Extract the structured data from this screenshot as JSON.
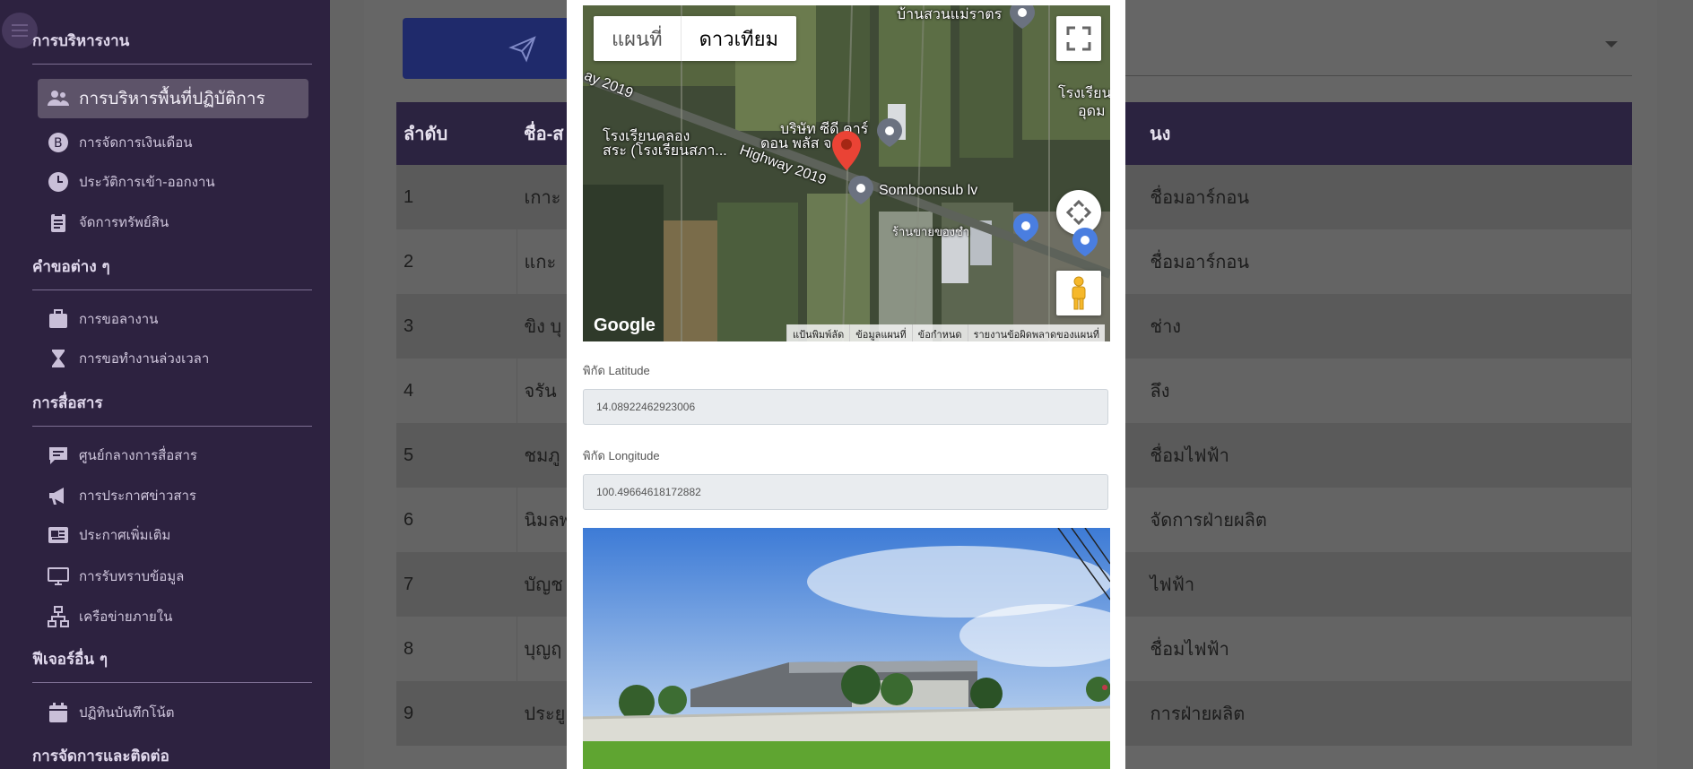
{
  "sidebar": {
    "sections": [
      {
        "title": "การบริหารงาน"
      },
      {
        "title": "คำขอต่าง ๆ"
      },
      {
        "title": "การสื่อสาร"
      },
      {
        "title": "ฟีเจอร์อื่น ๆ"
      },
      {
        "title": "การจัดการและติดต่อ"
      }
    ],
    "items": [
      {
        "label": "การบริหารพื้นที่ปฏิบัติการ",
        "icon": "users-icon",
        "active": true
      },
      {
        "label": "การจัดการเงินเดือน",
        "icon": "bitcoin-icon"
      },
      {
        "label": "ประวัติการเข้า-ออกงาน",
        "icon": "clock-icon"
      },
      {
        "label": "จัดการทรัพย์สิน",
        "icon": "clipboard-icon"
      },
      {
        "label": "การขอลางาน",
        "icon": "briefcase-icon"
      },
      {
        "label": "การขอทำงานล่วงเวลา",
        "icon": "hourglass-icon"
      },
      {
        "label": "ศูนย์กลางการสื่อสาร",
        "icon": "chat-icon"
      },
      {
        "label": "การประกาศข่าวสาร",
        "icon": "megaphone-icon"
      },
      {
        "label": "ประกาศเพิ่มเติม",
        "icon": "newspaper-icon"
      },
      {
        "label": "การรับทราบข้อมูล",
        "icon": "monitor-icon"
      },
      {
        "label": "เครือข่ายภายใน",
        "icon": "network-icon"
      },
      {
        "label": "ปฏิทินบันทึกโน้ต",
        "icon": "calendar-icon"
      }
    ]
  },
  "table": {
    "headers": [
      "ลำดับ",
      "ชื่อ-ส",
      "นง"
    ],
    "rows": [
      {
        "no": "1",
        "name": "เกาะ",
        "pos": "ชื่อมอาร์กอน"
      },
      {
        "no": "2",
        "name": "แกะ",
        "pos": "ชื่อมอาร์กอน"
      },
      {
        "no": "3",
        "name": "ขิง บุ",
        "pos": "ช่าง"
      },
      {
        "no": "4",
        "name": "จรัน",
        "pos": "ลึง"
      },
      {
        "no": "5",
        "name": "ชมภู",
        "pos": "ชื่อมไฟฟ้า"
      },
      {
        "no": "6",
        "name": "นิมลพ",
        "pos": "จัดการฝ่ายผลิต"
      },
      {
        "no": "7",
        "name": "บัญช",
        "pos": "ไฟฟ้า"
      },
      {
        "no": "8",
        "name": "บุญฤ",
        "pos": "ชื่อมไฟฟ้า"
      },
      {
        "no": "9",
        "name": "ประยู",
        "pos": "การฝ่ายผลิต"
      }
    ]
  },
  "map": {
    "type_map": "แผนที่",
    "type_satellite": "ดาวเทียม",
    "labels": {
      "place_top": "บ้านสวนแม่ราตร",
      "school_right": "โรงเรียน",
      "school_right2": "อุดม",
      "highway_left": "ay 2019",
      "school_left1": "โรงเรียนคลอง",
      "school_left2": "สระ (โรงเรียนสภา...",
      "company1": "บริษัท ซีดี คาร์",
      "company2": "ดอน พลัส จ...",
      "highway": "Highway 2019",
      "somboonsub": "Somboonsub lv",
      "shop": "ร้านขายของชำ"
    },
    "google": "Google",
    "footer": [
      "แป้นพิมพ์ลัด",
      "ข้อมูลแผนที่",
      "ข้อกำหนด",
      "รายงานข้อผิดพลาดของแผนที่"
    ]
  },
  "form": {
    "lat_label": "พิกัด Latitude",
    "lat_value": "14.08922462923006",
    "lng_label": "พิกัด Longitude",
    "lng_value": "100.49664618172882"
  }
}
